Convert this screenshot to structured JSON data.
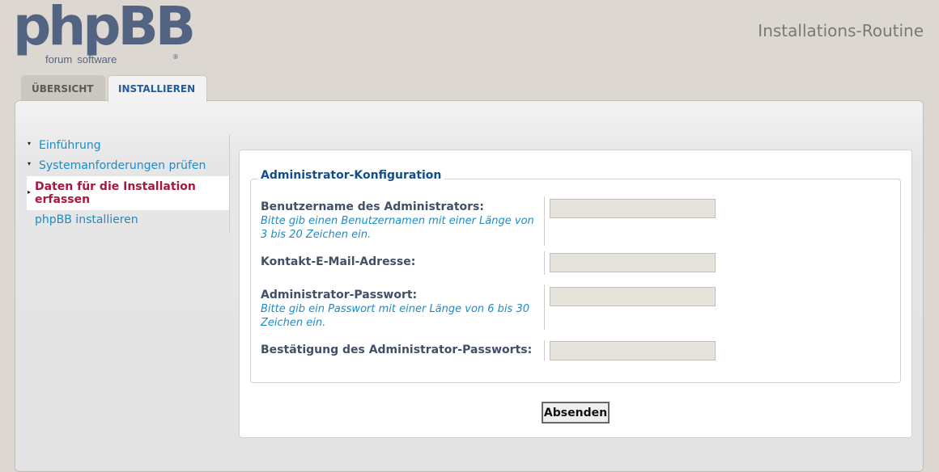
{
  "header": {
    "logo_text": "phpBB",
    "logo_sub_1": "forum",
    "logo_sub_2": "software",
    "logo_reg": "®",
    "title": "Installations-Routine"
  },
  "tabs": [
    {
      "label": "Übersicht",
      "active": false
    },
    {
      "label": "Installieren",
      "active": true
    }
  ],
  "sidebar": {
    "items": [
      {
        "label": "Einführung",
        "state": "done"
      },
      {
        "label": "Systemanforderungen prüfen",
        "state": "done"
      },
      {
        "label": "Daten für die Installation erfassen",
        "state": "active"
      },
      {
        "label": "phpBB installieren",
        "state": "pending"
      }
    ]
  },
  "form": {
    "legend": "Administrator-Konfiguration",
    "fields": [
      {
        "label": "Benutzername des Administrators:",
        "hint": "Bitte gib einen Benutzernamen mit einer Länge von 3 bis 20 Zeichen ein.",
        "value": ""
      },
      {
        "label": "Kontakt-E-Mail-Adresse:",
        "hint": "",
        "value": ""
      },
      {
        "label": "Administrator-Passwort:",
        "hint": "Bitte gib ein Passwort mit einer Länge von 6 bis 30 Zeichen ein.",
        "value": ""
      },
      {
        "label": "Bestätigung des Administrator-Passworts:",
        "hint": "",
        "value": ""
      }
    ],
    "submit_label": "Absenden"
  },
  "colors": {
    "page_bg": "#dcd8d1",
    "logo": "#536482",
    "link": "#1f8bc5",
    "active_item": "#a8183e",
    "legend": "#124e8c"
  }
}
